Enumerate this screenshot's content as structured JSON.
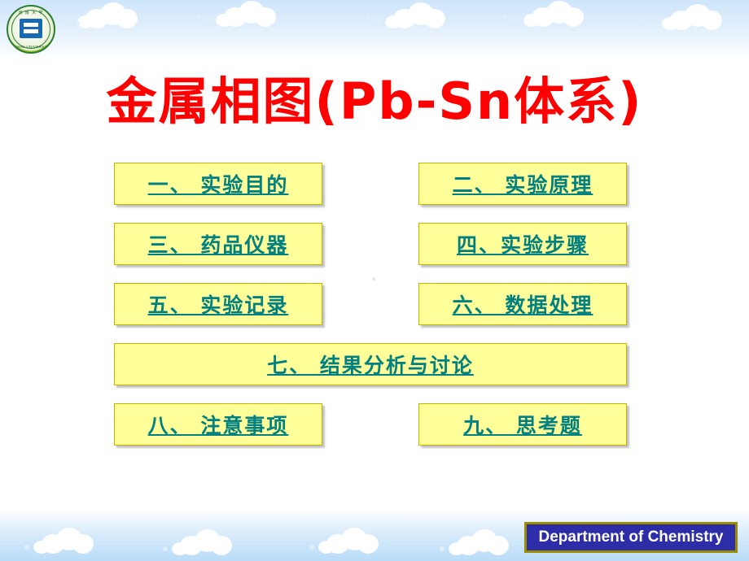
{
  "slide": {
    "title": "金属相图(Pb-Sn体系)",
    "logo": {
      "top_text": "河 南 大 学",
      "bottom_text": "HENAN UNIVERSITY",
      "name": "university-logo"
    },
    "menu_rows": [
      {
        "items": [
          {
            "label": "一、  实验目的",
            "name": "menu-item-experiment-purpose"
          },
          {
            "label": "二、  实验原理",
            "name": "menu-item-experiment-principle"
          }
        ]
      },
      {
        "items": [
          {
            "label": "三、  药品仪器",
            "name": "menu-item-reagents-instruments"
          },
          {
            "label": "四、实验步骤",
            "name": "menu-item-experiment-steps"
          }
        ]
      },
      {
        "items": [
          {
            "label": "五、  实验记录",
            "name": "menu-item-experiment-records"
          },
          {
            "label": "六、  数据处理",
            "name": "menu-item-data-processing"
          }
        ]
      },
      {
        "wide": true,
        "items": [
          {
            "label": "七、  结果分析与讨论",
            "name": "menu-item-results-discussion"
          }
        ]
      },
      {
        "items": [
          {
            "label": "八、  注意事项",
            "name": "menu-item-precautions"
          },
          {
            "label": "九、  思考题",
            "name": "menu-item-questions"
          }
        ]
      }
    ],
    "footer_badge": "Department of Chemistry",
    "colors": {
      "title": "#ff0000",
      "menu_text": "#008080",
      "menu_fill": "#ffff99",
      "menu_border": "#c8b400",
      "badge_fill": "#2d2da8",
      "badge_border": "#9a8e00",
      "band": "#cfe6fb"
    }
  }
}
